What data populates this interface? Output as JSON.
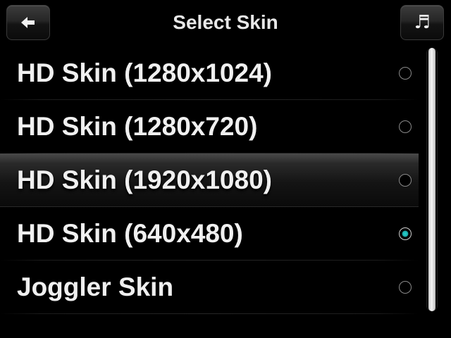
{
  "header": {
    "title": "Select Skin",
    "back_icon": "back-arrow-icon",
    "music_icon": "music-note-icon",
    "music_glyph": "♬"
  },
  "skins": {
    "items": [
      {
        "label": "HD Skin (1280x1024)",
        "checked": false,
        "highlighted": false
      },
      {
        "label": "HD Skin (1280x720)",
        "checked": false,
        "highlighted": false
      },
      {
        "label": "HD Skin (1920x1080)",
        "checked": false,
        "highlighted": true
      },
      {
        "label": "HD Skin (640x480)",
        "checked": true,
        "highlighted": false
      },
      {
        "label": "Joggler Skin",
        "checked": false,
        "highlighted": false
      }
    ]
  },
  "colors": {
    "background": "#000000",
    "text": "#f0f0f0",
    "radio_checked": "#2ad4d0"
  }
}
